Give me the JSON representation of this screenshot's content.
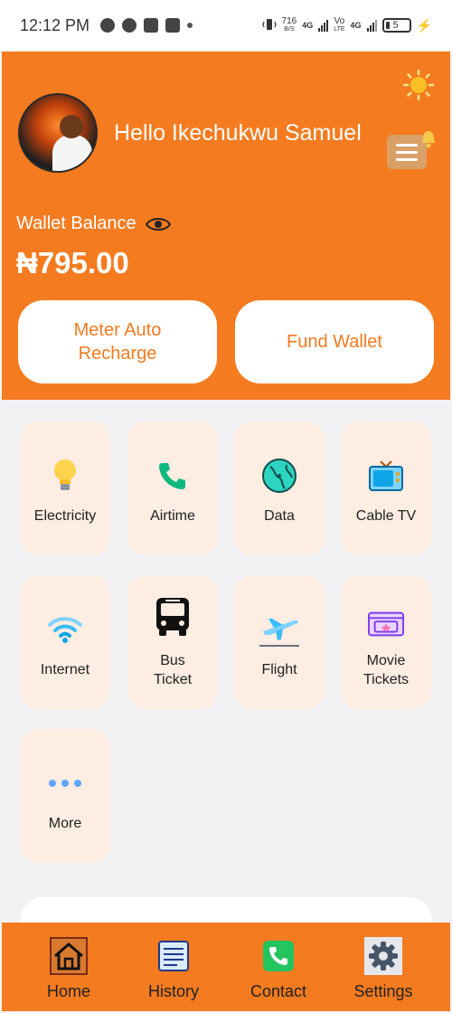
{
  "status_bar": {
    "time": "12:12 PM",
    "speed_value": "716",
    "speed_unit": "B/S",
    "network_1": "4G",
    "network_2_top": "Vo",
    "network_2_bottom": "LTE",
    "network_3": "4G",
    "battery": "5",
    "icons": [
      "bitcoin-icon",
      "discord-icon",
      "tiktok-icon",
      "bible-icon",
      "dot-icon",
      "vibrate-icon",
      "signal-icon",
      "charging-icon"
    ]
  },
  "header": {
    "greeting": "Hello Ikechukwu Samuel",
    "wallet_label": "Wallet Balance",
    "wallet_balance": "₦795.00",
    "meter_button": "Meter Auto Recharge",
    "fund_button": "Fund Wallet",
    "accent_color": "#f47b20"
  },
  "services": [
    {
      "label": "Electricity",
      "icon": "lightbulb-icon"
    },
    {
      "label": "Airtime",
      "icon": "phone-icon"
    },
    {
      "label": "Data",
      "icon": "globe-icon"
    },
    {
      "label": "Cable TV",
      "icon": "tv-icon"
    },
    {
      "label": "Internet",
      "icon": "wifi-icon"
    },
    {
      "label": "Bus Ticket",
      "icon": "bus-icon"
    },
    {
      "label": "Flight",
      "icon": "airplane-icon"
    },
    {
      "label": "Movie Tickets",
      "icon": "ticket-icon"
    },
    {
      "label": "More",
      "icon": "more-dots-icon"
    }
  ],
  "nav": [
    {
      "label": "Home",
      "icon": "home-icon"
    },
    {
      "label": "History",
      "icon": "history-icon"
    },
    {
      "label": "Contact",
      "icon": "contact-phone-icon"
    },
    {
      "label": "Settings",
      "icon": "settings-gear-icon"
    }
  ]
}
